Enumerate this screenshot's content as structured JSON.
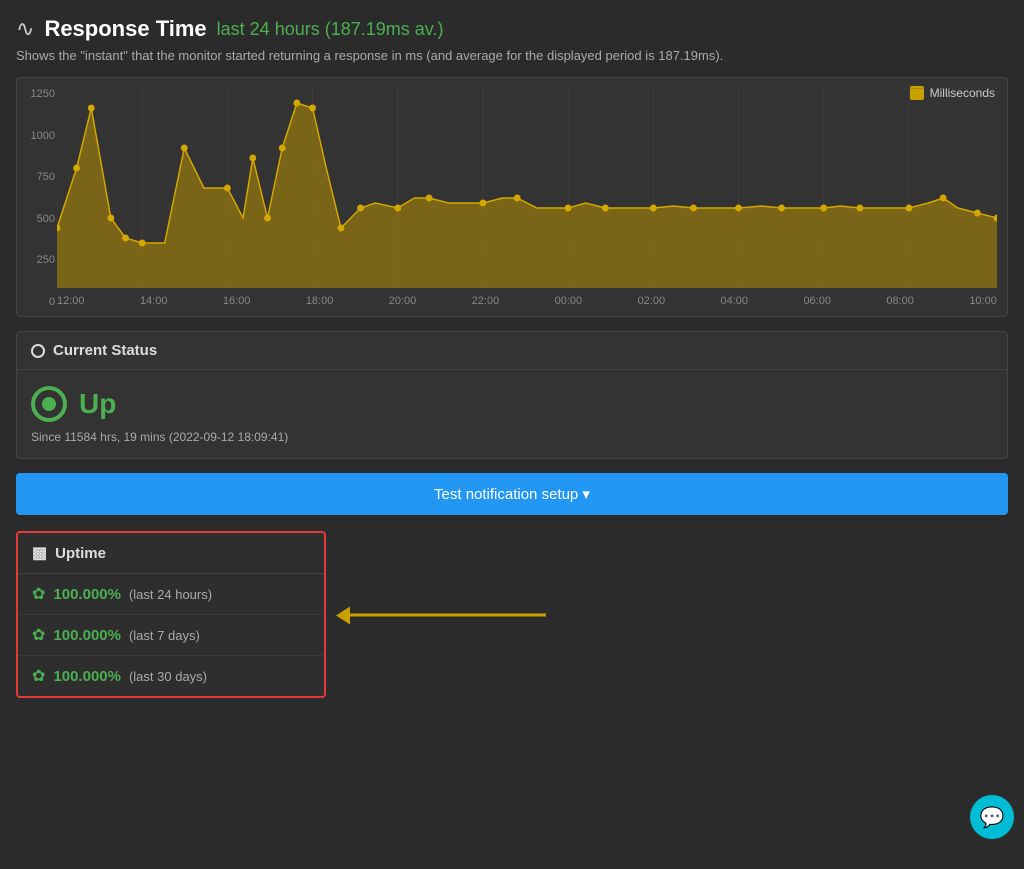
{
  "header": {
    "icon": "∿",
    "title": "Response Time",
    "subtitle": "last 24 hours (187.19ms av.)",
    "description": "Shows the \"instant\" that the monitor started returning a response in ms (and average for the displayed period is 187.19ms)."
  },
  "chart": {
    "legend_label": "Milliseconds",
    "y_axis_labels": [
      "1250",
      "1000",
      "750",
      "500",
      "250",
      "0"
    ],
    "x_axis_labels": [
      "12:00",
      "14:00",
      "16:00",
      "18:00",
      "20:00",
      "22:00",
      "00:00",
      "02:00",
      "04:00",
      "06:00",
      "08:00",
      "10:00"
    ]
  },
  "current_status": {
    "section_title": "Current Status",
    "status": "Up",
    "since_text": "Since 11584 hrs, 19 mins (2022-09-12 18:09:41)"
  },
  "test_notification": {
    "button_label": "Test notification setup ▾"
  },
  "uptime": {
    "section_title": "Uptime",
    "rows": [
      {
        "percent": "100.000%",
        "label": "(last 24 hours)"
      },
      {
        "percent": "100.000%",
        "label": "(last 7 days)"
      },
      {
        "percent": "100.000%",
        "label": "(last 30 days)"
      }
    ]
  },
  "chat_icon": "💬"
}
